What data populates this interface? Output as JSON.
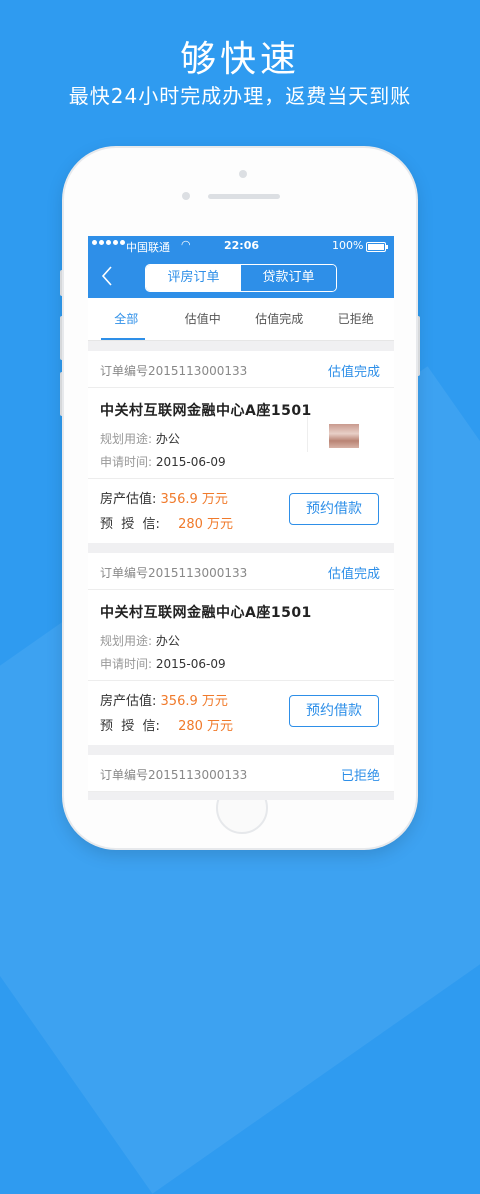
{
  "promo": {
    "title": "够快速",
    "subtitle": "最快24小时完成办理，返费当天到账"
  },
  "colors": {
    "primary": "#2e8fe8",
    "amount": "#f07a2b",
    "background": "#2f9bf0"
  },
  "statusbar": {
    "carrier": "中国联通",
    "time": "22:06",
    "battery": "100%",
    "wifi_icon": "wifi-icon"
  },
  "navbar": {
    "back_icon": "chevron-left-icon",
    "segments": [
      "评房订单",
      "贷款订单"
    ],
    "active_segment": 0
  },
  "tabs": {
    "items": [
      "全部",
      "估值中",
      "估值完成",
      "已拒绝"
    ],
    "active": 0
  },
  "orders": [
    {
      "order_no": "订单编号2015113000133",
      "status": "估值完成",
      "name": "中关村互联网金融中心A座1501",
      "usage_label": "规划用途:",
      "usage": "办公",
      "date_label": "申请时间:",
      "date": "2015-06-09",
      "valuation_label": "房产估值:",
      "valuation": "356.9 万元",
      "credit_label": "预  授  信:",
      "credit": "280 万元",
      "button": "预约借款"
    },
    {
      "order_no": "订单编号2015113000133",
      "status": "估值完成",
      "name": "中关村互联网金融中心A座1501",
      "usage_label": "规划用途:",
      "usage": "办公",
      "date_label": "申请时间:",
      "date": "2015-06-09",
      "valuation_label": "房产估值:",
      "valuation": "356.9 万元",
      "credit_label": "预  授  信:",
      "credit": "280 万元",
      "button": "预约借款"
    },
    {
      "order_no": "订单编号2015113000133",
      "status": "已拒绝"
    }
  ]
}
